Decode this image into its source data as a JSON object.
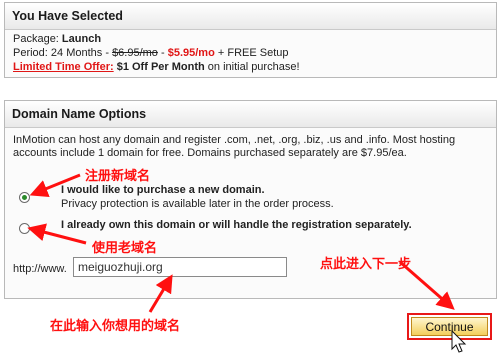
{
  "selected": {
    "title": "You Have Selected",
    "package_label": "Package: ",
    "package_value": "Launch",
    "period_prefix": "Period: 24 Months - ",
    "old_price": "$6.95/mo",
    "sep": " - ",
    "new_price": "$5.95/mo",
    "period_suffix": " + FREE Setup",
    "offer_label": "Limited Time Offer:",
    "offer_bold": " $1 Off Per Month",
    "offer_rest": " on initial purchase!"
  },
  "domain": {
    "title": "Domain Name Options",
    "description": "InMotion can host any domain and register .com, .net, .org, .biz, .us and .info. Most hosting accounts include 1 domain for free. Domains purchased separately are $7.95/ea.",
    "option1_label": "I would like to purchase a new domain.",
    "option1_note": "Privacy protection is available later in the order process.",
    "option2_label": "I already own this domain or will handle the registration separately.",
    "url_prefix": "http://www.",
    "url_value": "meiguozhuji.org"
  },
  "annotations": {
    "register_new": "注册新域名",
    "use_old": "使用老域名",
    "next_step": "点此进入下一步",
    "enter_domain": "在此输入你想用的域名"
  },
  "continue_label": "Continue",
  "colors": {
    "accent_red": "#e01616",
    "button_gold": "#f3cf5c"
  }
}
